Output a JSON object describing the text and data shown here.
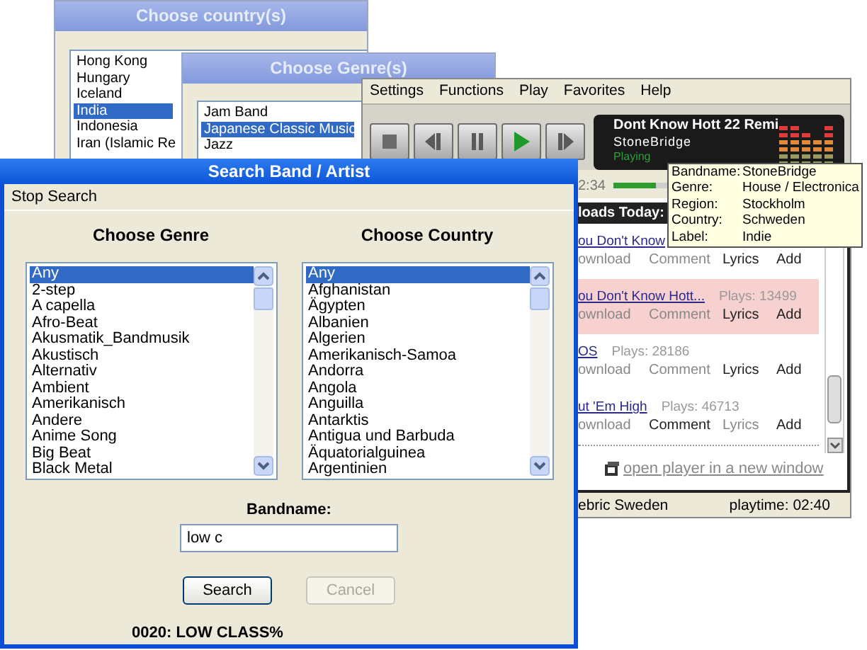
{
  "country_window": {
    "title": "Choose country(s)",
    "items": [
      {
        "label": "Hong Kong",
        "selected": false
      },
      {
        "label": "Hungary",
        "selected": false
      },
      {
        "label": "Iceland",
        "selected": false
      },
      {
        "label": "India",
        "selected": true
      },
      {
        "label": "Indonesia",
        "selected": false
      },
      {
        "label": "Iran (Islamic Re",
        "selected": false
      }
    ]
  },
  "genre_window": {
    "title": "Choose Genre(s)",
    "items": [
      {
        "label": "Jam Band",
        "selected": false
      },
      {
        "label": "Japanese Classic Music",
        "selected": true
      },
      {
        "label": "Jazz",
        "selected": false
      }
    ]
  },
  "player": {
    "menu": [
      "Settings",
      "Functions",
      "Play",
      "Favorites",
      "Help"
    ],
    "controls": [
      {
        "kind": "stop"
      },
      {
        "kind": "previous"
      },
      {
        "kind": "pause"
      },
      {
        "kind": "play"
      },
      {
        "kind": "next"
      }
    ],
    "now_playing": {
      "title": "Dont Know Hott 22 Remi",
      "artist": "StoneBridge",
      "status": "Playing"
    },
    "time": "2:34",
    "progress": {
      "level": 0.2
    },
    "tooltip": [
      {
        "label": "Bandname:",
        "value": "StoneBridge"
      },
      {
        "label": "Genre:",
        "value": "House / Electronica"
      },
      {
        "label": "Region:",
        "value": "Stockholm"
      },
      {
        "label": "Country:",
        "value": "Schweden"
      },
      {
        "label": "Label:",
        "value": "Indie"
      }
    ],
    "list_header": "loads Today:",
    "tracks": [
      {
        "title": "ou Don't Know",
        "highlighted": false,
        "actions": [
          {
            "label": "ownload",
            "active": false
          },
          {
            "label": "Comment",
            "active": false
          },
          {
            "label": "Lyrics",
            "active": true
          },
          {
            "label": "Add",
            "active": true
          }
        ]
      },
      {
        "title": "ou Don't Know Hott...",
        "plays": "Plays: 13499",
        "highlighted": true,
        "actions": [
          {
            "label": "ownload",
            "active": false
          },
          {
            "label": "Comment",
            "active": false
          },
          {
            "label": "Lyrics",
            "active": true
          },
          {
            "label": "Add",
            "active": true
          }
        ]
      },
      {
        "title": "OS",
        "plays": "Plays: 28186",
        "highlighted": false,
        "actions": [
          {
            "label": "ownload",
            "active": false
          },
          {
            "label": "Comment",
            "active": false
          },
          {
            "label": "Lyrics",
            "active": true
          },
          {
            "label": "Add",
            "active": true
          }
        ]
      },
      {
        "title": "ut 'Em High",
        "plays": "Plays: 46713",
        "highlighted": false,
        "actions": [
          {
            "label": "ownload",
            "active": false
          },
          {
            "label": "Comment",
            "active": true
          },
          {
            "label": "Lyrics",
            "active": false
          },
          {
            "label": "Add",
            "active": true
          }
        ]
      }
    ],
    "open_link": "open player in a new window",
    "status_bar": {
      "left": "ebric Sweden",
      "right": "playtime: 02:40"
    }
  },
  "search_window": {
    "title": "Search Band / Artist",
    "menu": [
      "Stop Search"
    ],
    "genre": {
      "heading": "Choose Genre",
      "items": [
        {
          "label": "Any",
          "selected": true
        },
        {
          "label": "2-step",
          "selected": false
        },
        {
          "label": "A capella",
          "selected": false
        },
        {
          "label": "Afro-Beat",
          "selected": false
        },
        {
          "label": "Akusmatik_Bandmusik",
          "selected": false
        },
        {
          "label": "Akustisch",
          "selected": false
        },
        {
          "label": "Alternativ",
          "selected": false
        },
        {
          "label": "Ambient",
          "selected": false
        },
        {
          "label": "Amerikanisch",
          "selected": false
        },
        {
          "label": "Andere",
          "selected": false
        },
        {
          "label": "Anime Song",
          "selected": false
        },
        {
          "label": "Big Beat",
          "selected": false
        },
        {
          "label": "Black Metal",
          "selected": false
        }
      ]
    },
    "country": {
      "heading": "Choose Country",
      "items": [
        {
          "label": "Any",
          "selected": true
        },
        {
          "label": "Afghanistan",
          "selected": false
        },
        {
          "label": "Ägypten",
          "selected": false
        },
        {
          "label": "Albanien",
          "selected": false
        },
        {
          "label": "Algerien",
          "selected": false
        },
        {
          "label": "Amerikanisch-Samoa",
          "selected": false
        },
        {
          "label": "Andorra",
          "selected": false
        },
        {
          "label": "Angola",
          "selected": false
        },
        {
          "label": "Anguilla",
          "selected": false
        },
        {
          "label": "Antarktis",
          "selected": false
        },
        {
          "label": "Antigua und Barbuda",
          "selected": false
        },
        {
          "label": "Äquatorialguinea",
          "selected": false
        },
        {
          "label": "Argentinien",
          "selected": false
        }
      ]
    },
    "bandname": {
      "label": "Bandname:",
      "value": "low c"
    },
    "buttons": [
      {
        "label": "Search",
        "disabled": false
      },
      {
        "label": "Cancel",
        "disabled": true
      }
    ],
    "result": "0020: LOW CLASS%"
  }
}
